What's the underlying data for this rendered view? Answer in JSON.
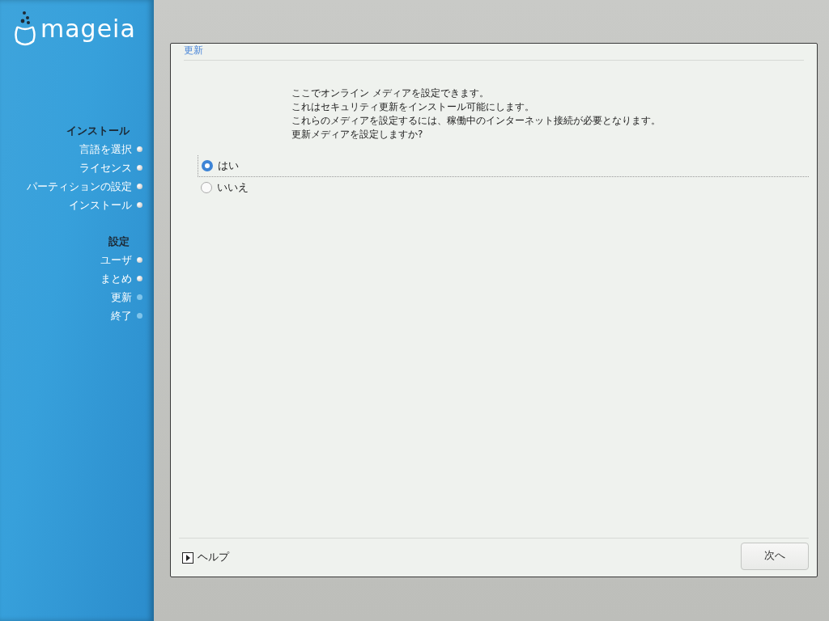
{
  "logo": {
    "text": "mageia"
  },
  "sidebar": {
    "sections": [
      {
        "title": "インストール",
        "steps": [
          {
            "label": "言語を選択",
            "done": true
          },
          {
            "label": "ライセンス",
            "done": true
          },
          {
            "label": "パーティションの設定",
            "done": true
          },
          {
            "label": "インストール",
            "done": true
          }
        ]
      },
      {
        "title": "設定",
        "steps": [
          {
            "label": "ユーザ",
            "done": true
          },
          {
            "label": "まとめ",
            "done": true
          },
          {
            "label": "更新",
            "done": false
          },
          {
            "label": "終了",
            "done": false
          }
        ]
      }
    ]
  },
  "panel": {
    "title": "更新",
    "message": [
      "ここでオンライン メディアを設定できます。",
      "これはセキュリティ更新をインストール可能にします。",
      "これらのメディアを設定するには、稼働中のインターネット接続が必要となります。",
      "更新メディアを設定しますか?"
    ],
    "options": [
      {
        "label": "はい",
        "selected": true
      },
      {
        "label": "いいえ",
        "selected": false
      }
    ],
    "help": "ヘルプ",
    "next": "次へ"
  }
}
